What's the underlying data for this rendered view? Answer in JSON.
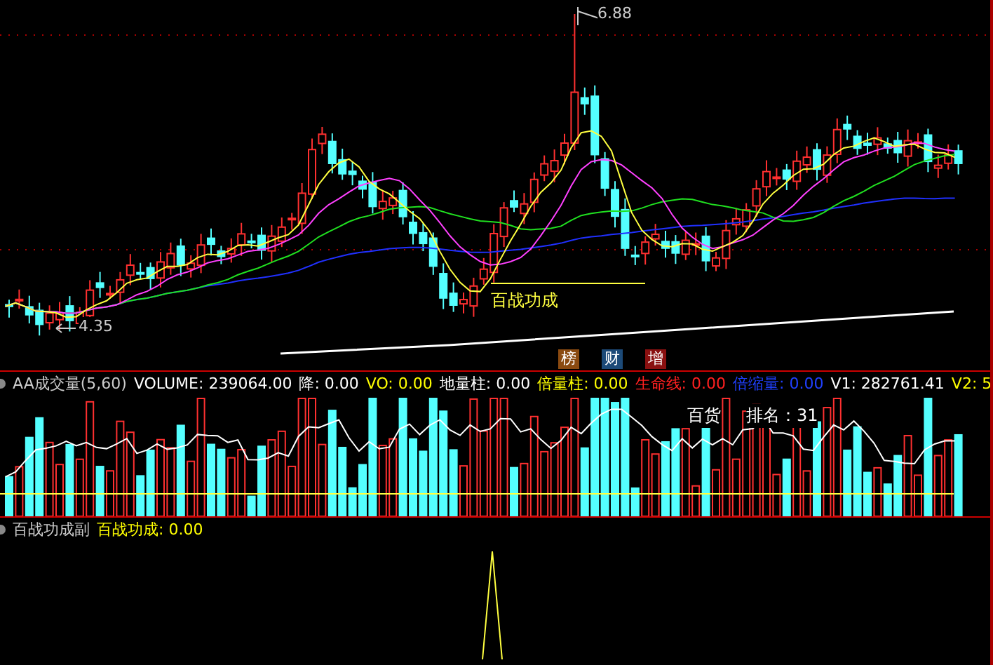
{
  "price_pane": {
    "high_label": "6.88",
    "low_label": "4.35",
    "signal_label": "百战功成",
    "badges": [
      {
        "text": "榜",
        "color": "#8a4a10"
      },
      {
        "text": "财",
        "color": "#1c4a78"
      },
      {
        "text": "增",
        "color": "#8a1010"
      }
    ]
  },
  "volume_pane": {
    "title": "AA成交量(5,60)",
    "readings": [
      {
        "text": "VOLUME: 239064.00",
        "color": "#ffffff"
      },
      {
        "text": "降: 0.00",
        "color": "#ffffff"
      },
      {
        "text": "VO: 0.00",
        "color": "#ffff00"
      },
      {
        "text": "地量柱: 0.00",
        "color": "#ffffff"
      },
      {
        "text": "倍量柱: 0.00",
        "color": "#ffff00"
      },
      {
        "text": "生命线: 0.00",
        "color": "#ff2020"
      },
      {
        "text": "倍缩量: 0.00",
        "color": "#2040ff"
      },
      {
        "text": "V1: 282761.41",
        "color": "#ffffff"
      },
      {
        "text": "V2: 5",
        "color": "#ffff00"
      }
    ],
    "sector": "百货",
    "rank": "排名：31"
  },
  "signal_pane": {
    "title": "百战功成副",
    "reading": "百战功成: 0.00"
  }
}
